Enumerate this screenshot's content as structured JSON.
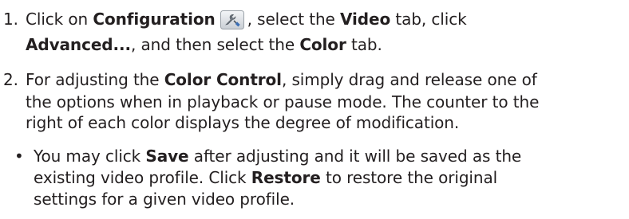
{
  "steps": [
    {
      "number": "1.",
      "t1": "Click on ",
      "b1": "Configuration",
      "icon": "configuration-icon",
      "t2": ", select the ",
      "b2": "Video",
      "t3": " tab, click",
      "b3": "Advanced...",
      "t4": ", and then select the ",
      "b4": "Color",
      "t5": " tab."
    },
    {
      "number": "2.",
      "t1": "For adjusting the ",
      "b1": "Color Control",
      "t2": ", simply drag and release one of",
      "line2": "the options when in playback or pause mode. The counter to the",
      "line3": "right of each color displays the degree of modification."
    }
  ],
  "bullet": {
    "mark": "•",
    "t1": "You may click ",
    "b1": "Save",
    "t2": " after adjusting and it will be saved as the",
    "line2_t1": "existing video profile. Click ",
    "line2_b1": "Restore",
    "line2_t2": " to restore the original",
    "line3": "settings for a given video profile."
  }
}
